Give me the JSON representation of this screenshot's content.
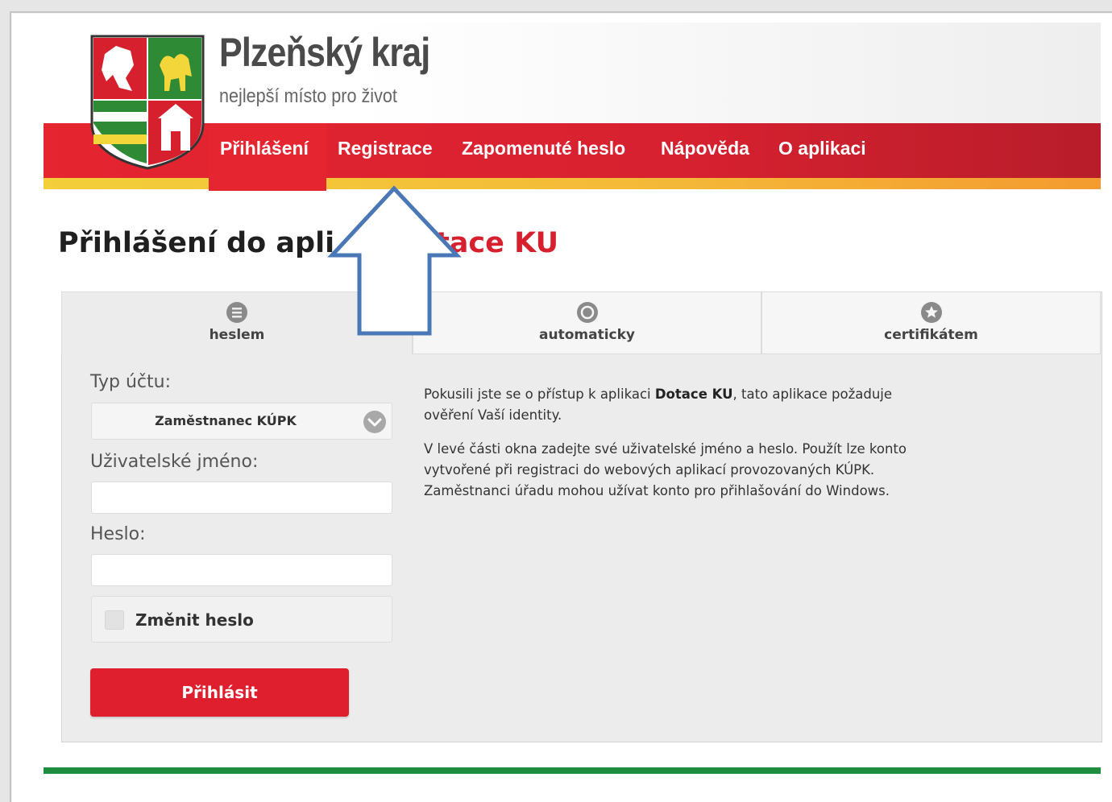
{
  "header": {
    "site_title": "Plzeňský kraj",
    "tagline": "nejlepší místo pro život"
  },
  "nav": {
    "items": [
      {
        "label": "Přihlášení",
        "active": true
      },
      {
        "label": "Registrace",
        "active": false
      },
      {
        "label": "Zapomenuté heslo",
        "active": false
      },
      {
        "label": "Nápověda",
        "active": false
      },
      {
        "label": "O aplikaci",
        "active": false
      }
    ]
  },
  "page": {
    "heading_part1": "Přihlášení do apli",
    "heading_part2": "tace KU"
  },
  "login_tabs": [
    {
      "label": "heslem",
      "icon": "list-icon",
      "active": true
    },
    {
      "label": "automaticky",
      "icon": "circle-icon",
      "active": false
    },
    {
      "label": "certifikátem",
      "icon": "star-badge-icon",
      "active": false
    }
  ],
  "form": {
    "account_type_label": "Typ účtu:",
    "account_type_value": "Zaměstnanec KÚPK",
    "username_label": "Uživatelské jméno:",
    "username_value": "",
    "password_label": "Heslo:",
    "password_value": "",
    "change_password_label": "Změnit heslo",
    "change_password_checked": false,
    "submit_label": "Přihlásit"
  },
  "info": {
    "p1_before": "Pokusili jste se o přístup k aplikaci ",
    "p1_bold": "Dotace KU",
    "p1_after": ", tato aplikace požaduje ověření Vaší identity.",
    "p2": "V levé části okna zadejte své uživatelské jméno a heslo. Použít lze konto vytvořené při registraci do webových aplikací provozovaných KÚPK. Zaměstnanci úřadu mohou užívat konto pro přihlašování do Windows."
  },
  "colors": {
    "brand_red": "#e52530",
    "brand_yellow": "#f3cf3a",
    "footer_green": "#1e8e3e",
    "annotation_arrow": "#4a77b5"
  }
}
